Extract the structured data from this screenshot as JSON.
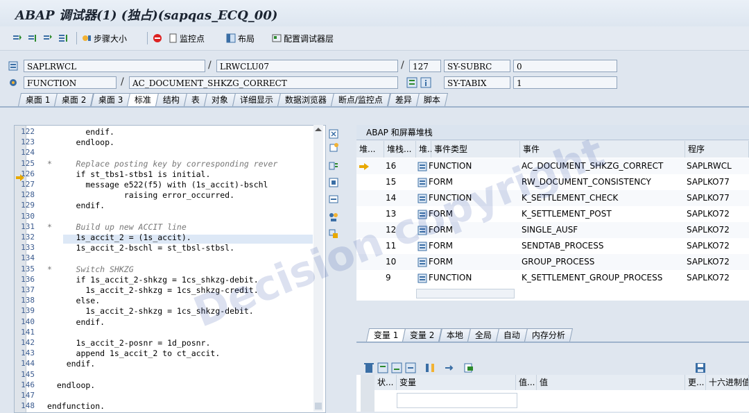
{
  "title": "ABAP 调试器(1) (独占)(sapqas_ECQ_00)",
  "toolbar": {
    "step_size": "步骤大小",
    "watchpoint": "监控点",
    "layout": "布局",
    "config_layers": "配置调试器层"
  },
  "header": {
    "program": "SAPLRWCL",
    "include": "LRWCLU07",
    "line": "127",
    "sy_subrc_label": "SY-SUBRC",
    "sy_subrc_value": "0",
    "event_type": "FUNCTION",
    "event": "AC_DOCUMENT_SHKZG_CORRECT",
    "sy_tabix_label": "SY-TABIX",
    "sy_tabix_value": "1"
  },
  "tabs": [
    "桌面 1",
    "桌面 2",
    "桌面 3",
    "标准",
    "结构",
    "表",
    "对象",
    "详细显示",
    "数据浏览器",
    "断点/监控点",
    "差异",
    "脚本"
  ],
  "code_lines": [
    {
      "n": "122",
      "t": "        endif."
    },
    {
      "n": "123",
      "t": "      endloop."
    },
    {
      "n": "124",
      "t": ""
    },
    {
      "n": "125",
      "t": "*     Replace posting key by corresponding rever"
    },
    {
      "n": "126",
      "t": "      if st_tbs1-stbs1 is initial."
    },
    {
      "n": "127",
      "t": "        message e522(f5) with (1s_accit)-bschl"
    },
    {
      "n": "128",
      "t": "                raising error_occurred."
    },
    {
      "n": "129",
      "t": "      endif."
    },
    {
      "n": "130",
      "t": ""
    },
    {
      "n": "131",
      "t": "*     Build up new ACCIT line"
    },
    {
      "n": "132",
      "t": "      1s_accit_2 = (1s_accit)."
    },
    {
      "n": "133",
      "t": "      1s_accit_2-bschl = st_tbsl-stbsl."
    },
    {
      "n": "134",
      "t": ""
    },
    {
      "n": "135",
      "t": "*     Switch SHKZG"
    },
    {
      "n": "136",
      "t": "      if 1s_accit_2-shkzg = 1cs_shkzg-debit."
    },
    {
      "n": "137",
      "t": "        1s_accit_2-shkzg = 1cs_shkzg-credit."
    },
    {
      "n": "138",
      "t": "      else."
    },
    {
      "n": "139",
      "t": "        1s_accit_2-shkzg = 1cs_shkzg-debit."
    },
    {
      "n": "140",
      "t": "      endif."
    },
    {
      "n": "141",
      "t": ""
    },
    {
      "n": "142",
      "t": "      1s_accit_2-posnr = 1d_posnr."
    },
    {
      "n": "143",
      "t": "      append 1s_accit_2 to ct_accit."
    },
    {
      "n": "144",
      "t": "    endif."
    },
    {
      "n": "145",
      "t": ""
    },
    {
      "n": "146",
      "t": "  endloop."
    },
    {
      "n": "147",
      "t": ""
    },
    {
      "n": "148",
      "t": "endfunction."
    }
  ],
  "stack": {
    "title": "ABAP 和屏幕堆栈",
    "columns": [
      "堆...",
      "堆栈...",
      "堆...",
      "事件类型",
      "事件",
      "程序"
    ],
    "rows": [
      {
        "level": "16",
        "type": "FUNCTION",
        "event": "AC_DOCUMENT_SHKZG_CORRECT",
        "program": "SAPLRWCL",
        "current": true
      },
      {
        "level": "15",
        "type": "FORM",
        "event": "RW_DOCUMENT_CONSISTENCY",
        "program": "SAPLKO77"
      },
      {
        "level": "14",
        "type": "FUNCTION",
        "event": "K_SETTLEMENT_CHECK",
        "program": "SAPLKO77"
      },
      {
        "level": "13",
        "type": "FORM",
        "event": "K_SETTLEMENT_POST",
        "program": "SAPLKO72"
      },
      {
        "level": "12",
        "type": "FORM",
        "event": "SINGLE_AUSF",
        "program": "SAPLKO72"
      },
      {
        "level": "11",
        "type": "FORM",
        "event": "SENDTAB_PROCESS",
        "program": "SAPLKO72"
      },
      {
        "level": "10",
        "type": "FORM",
        "event": "GROUP_PROCESS",
        "program": "SAPLKO72"
      },
      {
        "level": "9",
        "type": "FUNCTION",
        "event": "K_SETTLEMENT_GROUP_PROCESS",
        "program": "SAPLKO72"
      }
    ]
  },
  "var_tabs": [
    "变量 1",
    "变量 2",
    "本地",
    "全局",
    "自动",
    "内存分析"
  ],
  "var_columns": [
    "状...",
    "变量",
    "值...",
    "值",
    "更...",
    "十六进制值"
  ],
  "watermark": "Decision copyright"
}
